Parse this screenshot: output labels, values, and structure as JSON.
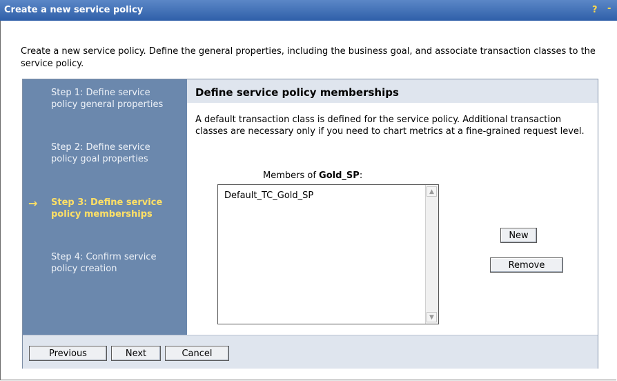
{
  "window": {
    "title": "Create a new service policy",
    "help_label": "?",
    "minimize_label": "-"
  },
  "intro": "Create a new service policy. Define the general properties, including the business goal, and associate transaction classes to the service policy.",
  "steps": [
    {
      "label": "Step 1: Define service policy general properties",
      "current": false
    },
    {
      "label": "Step 2: Define service policy goal properties",
      "current": false
    },
    {
      "label": "Step 3: Define service policy memberships",
      "current": true
    },
    {
      "label": "Step 4: Confirm service policy creation",
      "current": false
    }
  ],
  "current_arrow": "→",
  "content": {
    "heading": "Define service policy memberships",
    "description": "A default transaction class is defined for the service policy. Additional transaction classes are necessary only if you need to chart metrics at a fine-grained request level.",
    "members_prefix": "Members of ",
    "members_name": "Gold_SP",
    "members_suffix": ":",
    "members": [
      "Default_TC_Gold_SP"
    ]
  },
  "buttons": {
    "new": "New",
    "remove": "Remove",
    "previous": "Previous",
    "next": "Next",
    "cancel": "Cancel"
  },
  "colors": {
    "titlebar": "#2f5fa9",
    "sidebar": "#6b88ad",
    "current_step": "#ffe066",
    "header": "#dfe5ee"
  }
}
